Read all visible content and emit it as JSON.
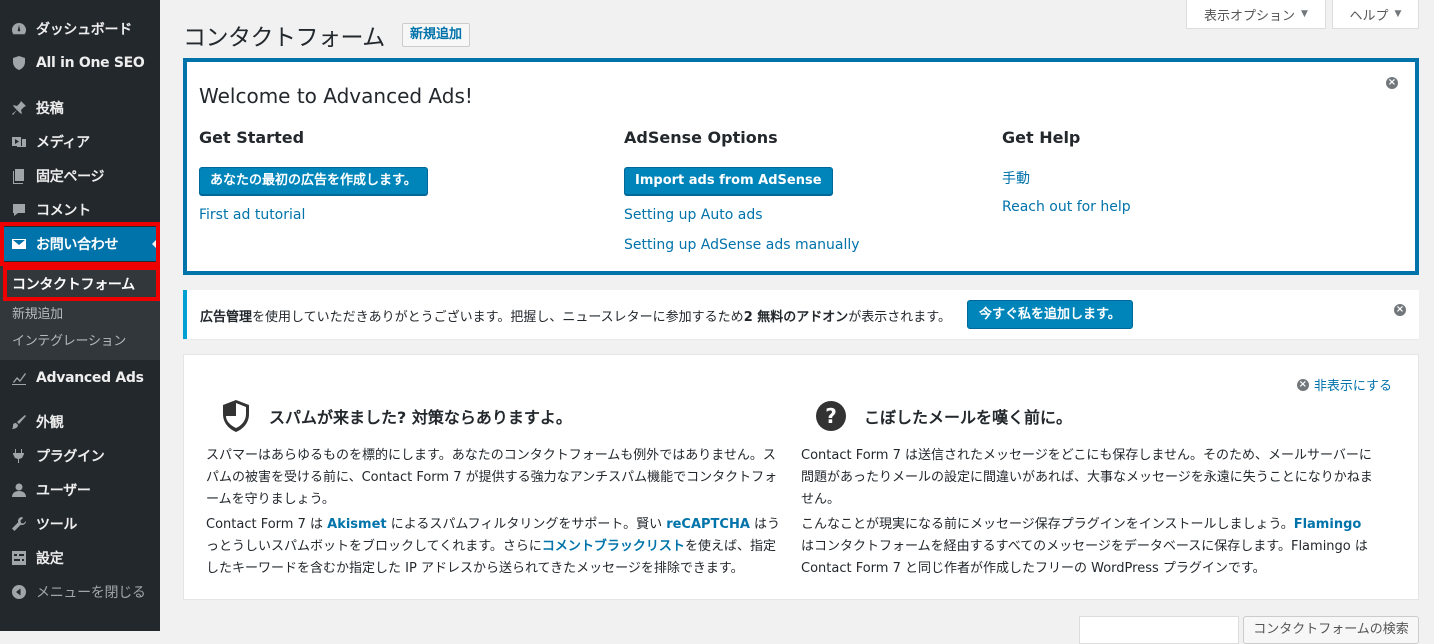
{
  "sidebar": {
    "items": [
      {
        "label": "ダッシュボード",
        "icon": "dashboard-icon"
      },
      {
        "label": "All in One SEO",
        "icon": "shield-icon"
      },
      {
        "label": "投稿",
        "icon": "pin-icon"
      },
      {
        "label": "メディア",
        "icon": "media-icon"
      },
      {
        "label": "固定ページ",
        "icon": "page-icon"
      },
      {
        "label": "コメント",
        "icon": "comment-icon"
      },
      {
        "label": "お問い合わせ",
        "icon": "mail-icon"
      },
      {
        "label": "Advanced Ads",
        "icon": "chart-icon"
      },
      {
        "label": "外観",
        "icon": "brush-icon"
      },
      {
        "label": "プラグイン",
        "icon": "plugin-icon"
      },
      {
        "label": "ユーザー",
        "icon": "user-icon"
      },
      {
        "label": "ツール",
        "icon": "wrench-icon"
      },
      {
        "label": "設定",
        "icon": "settings-icon"
      },
      {
        "label": "メニューを閉じる",
        "icon": "collapse-icon"
      }
    ],
    "submenu": [
      {
        "label": "コンタクトフォーム"
      },
      {
        "label": "新規追加"
      },
      {
        "label": "インテグレーション"
      }
    ]
  },
  "header": {
    "title": "コンタクトフォーム",
    "add_new": "新規追加",
    "screen_options": "表示オプション",
    "help": "ヘルプ"
  },
  "welcome": {
    "title": "Welcome to Advanced Ads!",
    "col1": {
      "heading": "Get Started",
      "button": "あなたの最初の広告を作成します。",
      "link": "First ad tutorial"
    },
    "col2": {
      "heading": "AdSense Options",
      "button": "Import ads from AdSense",
      "link1": "Setting up Auto ads",
      "link2": "Setting up AdSense ads manually"
    },
    "col3": {
      "heading": "Get Help",
      "link1": "手動",
      "link2": "Reach out for help"
    }
  },
  "notice": {
    "bold1": "広告管理",
    "text1": "を使用していただきありがとうございます。把握し、ニュースレターに参加するため",
    "bold2": "2 無料のアドオン",
    "text2": "が表示されます。",
    "button": "今すぐ私を追加します。"
  },
  "cf7": {
    "dismiss": "非表示にする",
    "spam": {
      "heading": "スパムが来ました? 対策ならありますよ。",
      "p1": "スパマーはあらゆるものを標的にします。あなたのコンタクトフォームも例外ではありません。スパムの被害を受ける前に、Contact Form 7 が提供する強力なアンチスパム機能でコンタクトフォームを守りましょう。",
      "p2_a": "Contact Form 7 は ",
      "p2_link1": "Akismet",
      "p2_b": " によるスパムフィルタリングをサポート。賢い ",
      "p2_link2": "reCAPTCHA",
      "p2_c": " はうっとうしいスパムボットをブロックしてくれます。さらに",
      "p2_link3": "コメントブラックリスト",
      "p2_d": "を使えば、指定したキーワードを含むか指定した IP アドレスから送られてきたメッセージを排除できます。"
    },
    "mail": {
      "heading": "こぼしたメールを嘆く前に。",
      "p1": "Contact Form 7 は送信されたメッセージをどこにも保存しません。そのため、メールサーバーに問題があったりメールの設定に間違いがあれば、大事なメッセージを永遠に失うことになりかねません。",
      "p2_a": "こんなことが現実になる前にメッセージ保存プラグインをインストールしましょう。",
      "p2_link": "Flamingo",
      "p2_b": " はコンタクトフォームを経由するすべてのメッセージをデータベースに保存します。Flamingo は Contact Form 7 と同じ作者が作成したフリーの WordPress プラグインです。"
    }
  },
  "search": {
    "button": "コンタクトフォームの検索"
  },
  "colors": {
    "accent": "#0073aa",
    "sidebar_bg": "#23282d",
    "highlight": "#ee0000",
    "button": "#0085ba"
  }
}
